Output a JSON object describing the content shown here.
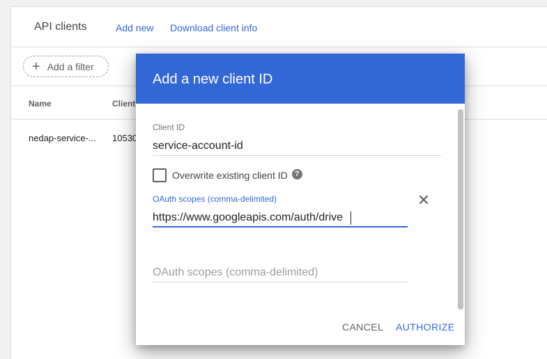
{
  "page": {
    "title": "API clients",
    "links": {
      "add_new": "Add new",
      "download": "Download client info"
    },
    "filter": {
      "label": "Add a filter"
    },
    "table": {
      "columns": [
        "Name",
        "Client"
      ],
      "rows": [
        {
          "name": "nedap-service-...",
          "client": "10530"
        }
      ]
    }
  },
  "dialog": {
    "title": "Add a new client ID",
    "client_id": {
      "label": "Client ID",
      "value": "service-account-id"
    },
    "overwrite": {
      "label": "Overwrite existing client ID",
      "checked": false
    },
    "scope1": {
      "label": "OAuth scopes (comma-delimited)",
      "value": "https://www.googleapis.com/auth/drive"
    },
    "scope2": {
      "placeholder": "OAuth scopes (comma-delimited)"
    },
    "buttons": {
      "cancel": "CANCEL",
      "authorize": "AUTHORIZE"
    }
  },
  "colors": {
    "accent": "#3367d6"
  },
  "icons": {
    "plus": "plus-icon",
    "help": "help-icon",
    "close": "close-icon"
  }
}
